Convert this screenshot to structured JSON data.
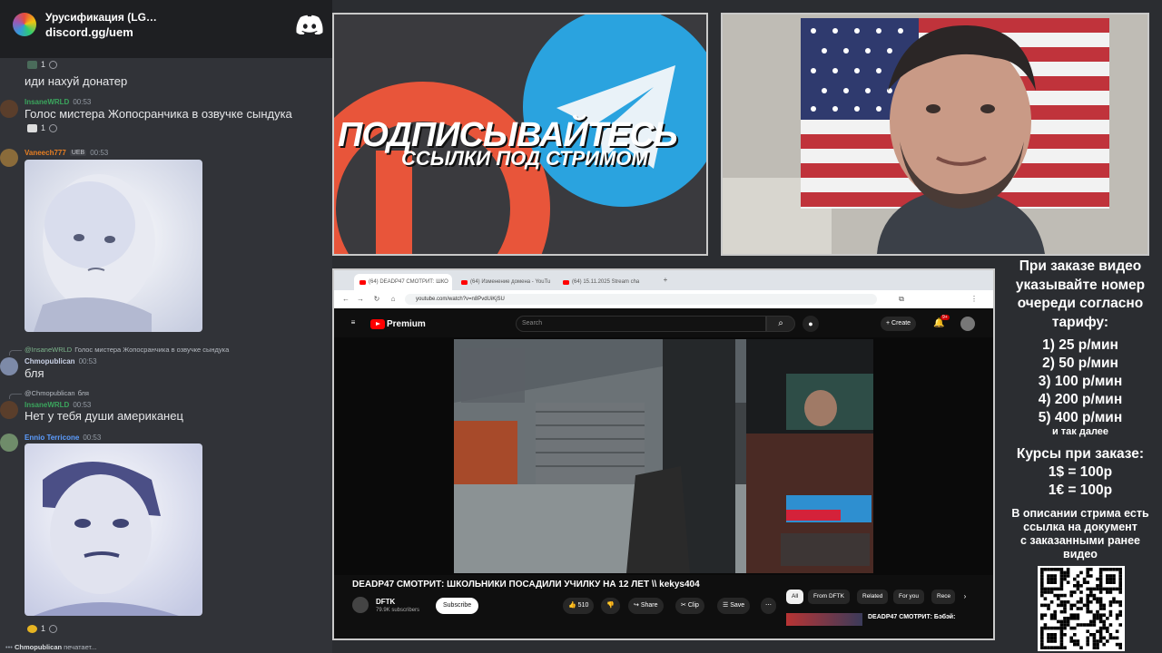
{
  "discord": {
    "server_name": "Урусификация (LG…",
    "invite": "discord.gg/uem",
    "messages": {
      "m1_reaction_count": "1",
      "m1_text": "иди нахуй донатер",
      "m2_author": "InsaneWRLD",
      "m2_time": "00:53",
      "m2_text": "Голос мистера Жопосранчика в озвучке сындука",
      "m2_reaction_count": "1",
      "m3_author": "Vaneech777",
      "m3_tag": "UEB",
      "m3_time": "00:53",
      "m4_reply_author": "@InsaneWRLD",
      "m4_reply_text": "Голос мистера Жопосранчика в озвучке сындука",
      "m4_author": "Chmopublican",
      "m4_time": "00:53",
      "m4_text": "бля",
      "m5_reply_author": "@Chmopublican",
      "m5_reply_text": "бля",
      "m5_author": "InsaneWRLD",
      "m5_time": "00:53",
      "m5_text": "Нет у тебя души американец",
      "m6_author": "Ennio Terricone",
      "m6_time": "00:53",
      "m6_reaction_count": "1"
    },
    "typing_user": "Chmopublican",
    "typing_text": "печатает..."
  },
  "promo": {
    "title": "ПОДПИСЫВАЙТЕСЬ",
    "subtitle": "ССЫЛКИ ПОД СТРИМОМ"
  },
  "browser": {
    "tabs": [
      {
        "label": "(64) DEADP47 СМОТРИТ: ШКО"
      },
      {
        "label": "(64) Изменение домена - YouTu"
      },
      {
        "label": "(64) 15.11.2025 Stream cha"
      }
    ],
    "url": "youtube.com/watch?v=n8PvdUiKjSU",
    "brand": "Premium",
    "search_placeholder": "Search",
    "create_label": "Create",
    "notif_badge": "9+",
    "video_title": "DEADP47 СМОТРИТ: ШКОЛЬНИКИ ПОСАДИЛИ УЧИЛКУ НА 12 ЛЕТ \\\\ kekys404",
    "channel_name": "DFTK",
    "channel_subs": "79.9K subscribers",
    "subscribe_label": "Subscribe",
    "likes": "510",
    "share_label": "Share",
    "clip_label": "Clip",
    "save_label": "Save",
    "chips": [
      "All",
      "From DFTK",
      "Related",
      "For you",
      "Rece"
    ],
    "related_title": "DEADP47 СМОТРИТ: Бэбэй:"
  },
  "info": {
    "order_lines": [
      "При заказе видео",
      "указывайте номер",
      "очереди согласно",
      "тарифу:"
    ],
    "rates": [
      "1) 25 р/мин",
      "2) 50 р/мин",
      "3) 100 р/мин",
      "4) 200 р/мин",
      "5) 400 р/мин"
    ],
    "etc": "и так далее",
    "courses_title": "Курсы при заказе:",
    "courses": [
      "1$ = 100р",
      "1€ = 100р"
    ],
    "desc_lines": [
      "В описании стрима есть",
      "ссылка на документ",
      "с заказанными ранее",
      "видео"
    ]
  },
  "colors": {
    "discord_bg": "#313338",
    "author_green": "#3ba55d",
    "author_orange": "#e67e22",
    "author_blue": "#5c9dff",
    "youtube_red": "#ff0000",
    "telegram_blue": "#2aa3df",
    "patreon_red": "#e8553a"
  }
}
